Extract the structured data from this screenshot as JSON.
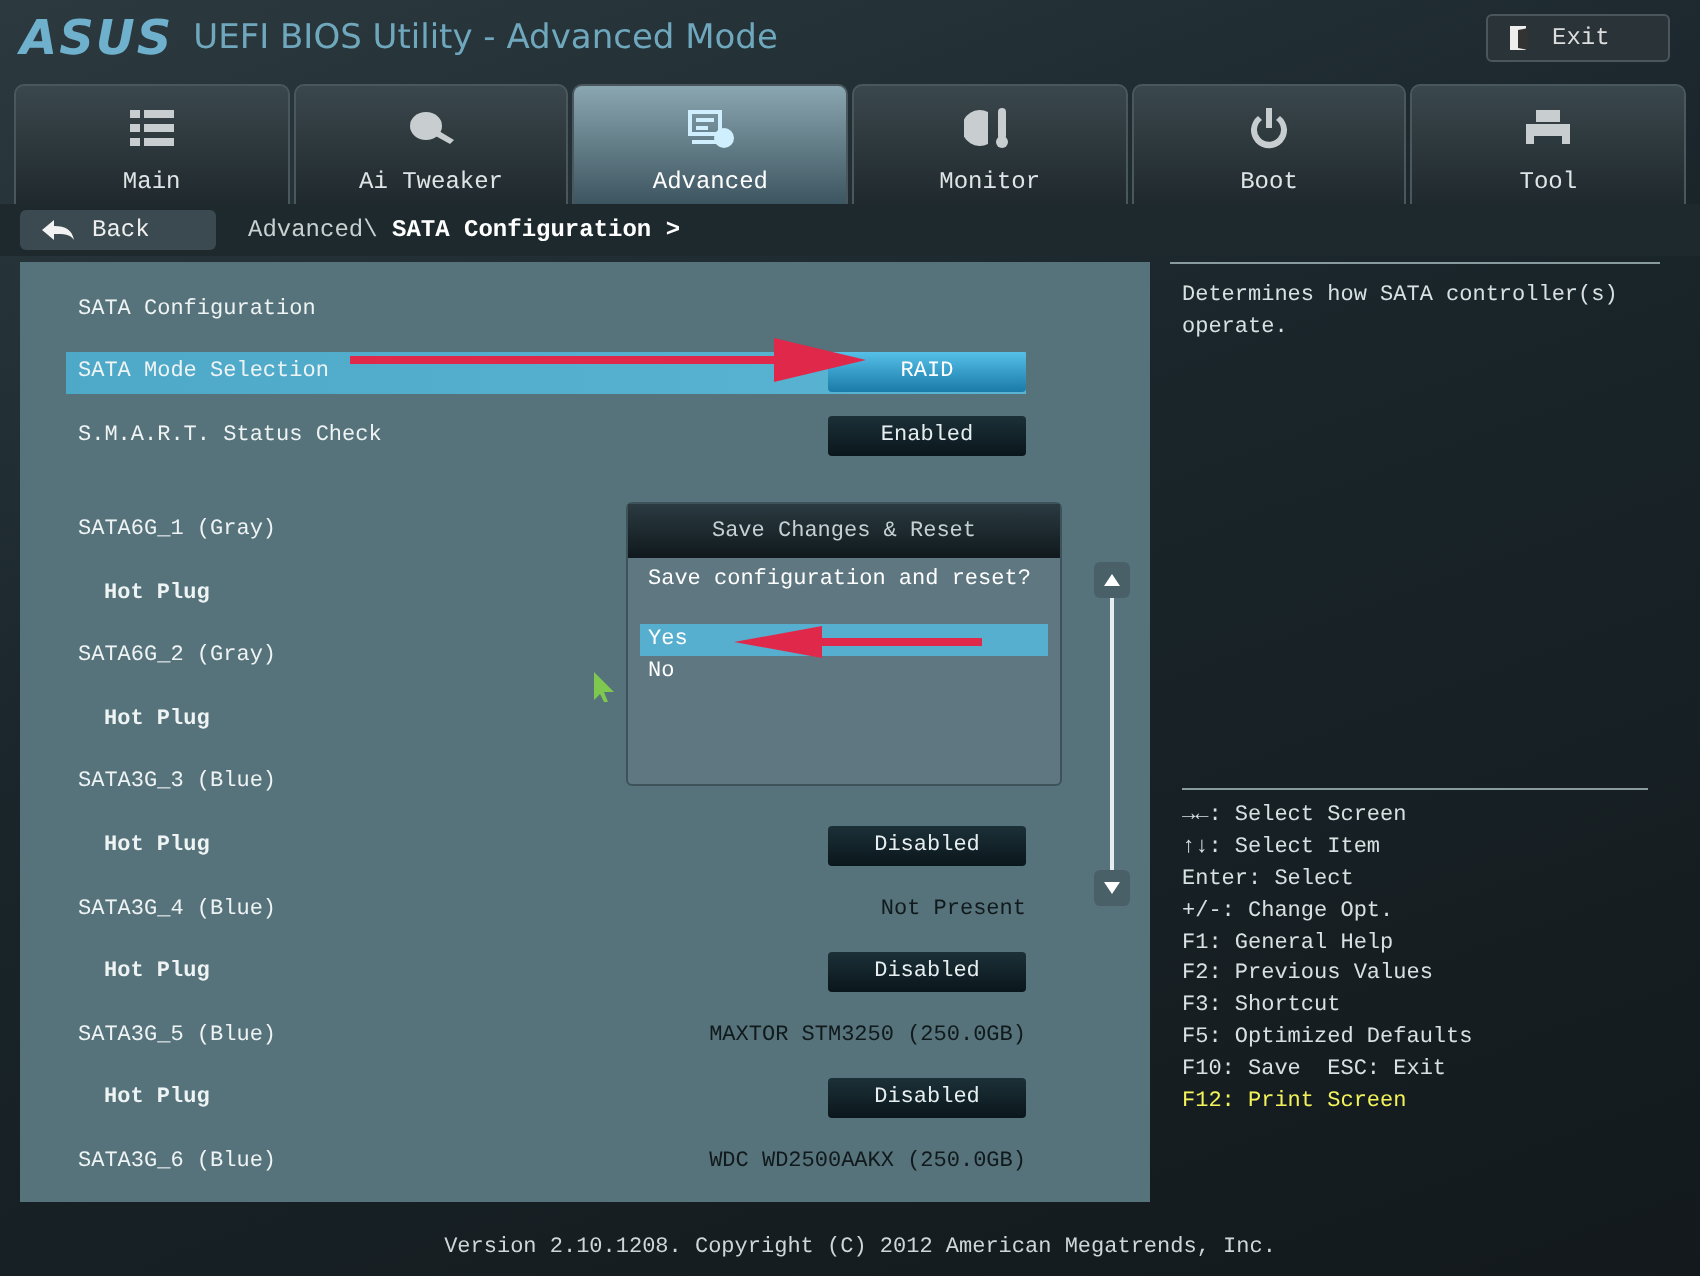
{
  "header": {
    "logo": "ASUS",
    "title": "UEFI BIOS Utility - Advanced Mode",
    "exit_button": "Exit"
  },
  "tabs": [
    {
      "label": "Main",
      "selected": false
    },
    {
      "label": "Ai Tweaker",
      "selected": false
    },
    {
      "label": "Advanced",
      "selected": true
    },
    {
      "label": "Monitor",
      "selected": false
    },
    {
      "label": "Boot",
      "selected": false
    },
    {
      "label": "Tool",
      "selected": false
    }
  ],
  "breadcrumb": {
    "back_button": "Back",
    "path": "Advanced\\ **SATA Configuration >**"
  },
  "settings": [
    {
      "label": "SATA Configuration",
      "selected": false
    },
    {
      "label": "SATA Mode Selection",
      "selected": true,
      "value": {
        "kind": "button",
        "text": "RAID"
      }
    },
    {
      "label": "S.M.A.R.T. Status Check",
      "selected": false,
      "value": {
        "kind": "button",
        "text": "Enabled"
      }
    }
  ],
  "ports": [
    {
      "label": "SATA6G_1 (Gray)",
      "children": [
        {
          "label": "Hot Plug"
        }
      ]
    },
    {
      "label": "SATA6G_2 (Gray)",
      "children": [
        {
          "label": "Hot Plug"
        }
      ]
    },
    {
      "label": "SATA3G_3 (Blue)",
      "children": [
        {
          "label": "Hot Plug",
          "value": {
            "kind": "button",
            "text": "Disabled"
          }
        }
      ]
    },
    {
      "label": "SATA3G_4 (Blue)",
      "value": {
        "kind": "text",
        "text": "Not Present"
      },
      "children": [
        {
          "label": "Hot Plug",
          "value": {
            "kind": "button",
            "text": "Disabled"
          }
        }
      ]
    },
    {
      "label": "SATA3G_5 (Blue)",
      "value": {
        "kind": "text",
        "text": "MAXTOR STM3250 (250.0GB)"
      },
      "children": [
        {
          "label": "Hot Plug",
          "value": {
            "kind": "button",
            "text": "Disabled"
          }
        }
      ]
    },
    {
      "label": "SATA3G_6 (Blue)",
      "value": {
        "kind": "text",
        "text": "WDC WD2500AAKX (250.0GB)"
      }
    }
  ],
  "dialog": {
    "title": "Save Changes & Reset",
    "question": "Save configuration and reset?",
    "options": [
      {
        "label": "Yes",
        "selected": true
      },
      {
        "label": "No",
        "selected": false
      }
    ]
  },
  "help": {
    "description": "Determines how SATA controller(s) operate.",
    "keys": [
      {
        "text": "→←: Select Screen",
        "highlighted": false
      },
      {
        "text": "↑↓: Select Item",
        "highlighted": false
      },
      {
        "text": "Enter: Select",
        "highlighted": false
      },
      {
        "text": "+/-: Change Opt.",
        "highlighted": false
      },
      {
        "text": "F1: General Help",
        "highlighted": false
      },
      {
        "text": "F2: Previous Values",
        "highlighted": false
      },
      {
        "text": "F3: Shortcut",
        "highlighted": false
      },
      {
        "text": "F5: Optimized Defaults",
        "highlighted": false
      },
      {
        "text": "F10: Save  ESC: Exit",
        "highlighted": false
      },
      {
        "text": "F12: Print Screen",
        "highlighted": true
      }
    ]
  },
  "footer": "Version 2.10.1208. Copyright (C) 2012 American Megatrends, Inc."
}
